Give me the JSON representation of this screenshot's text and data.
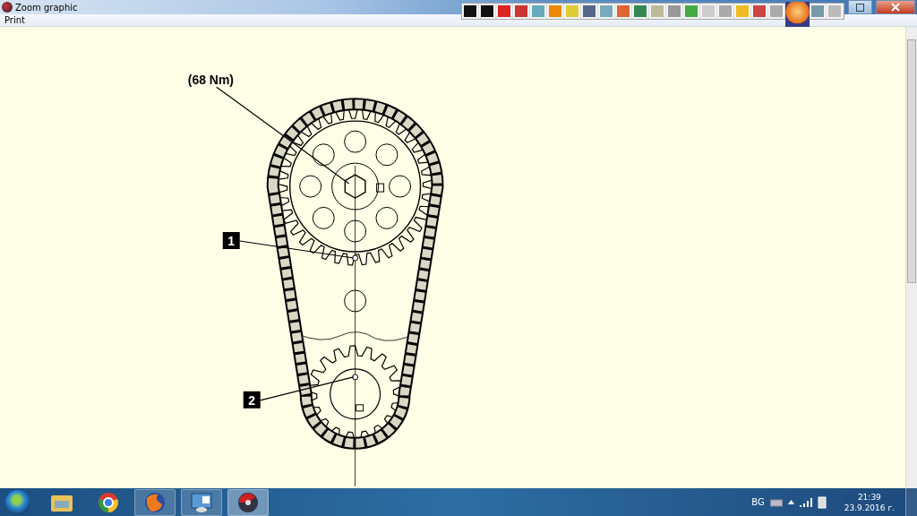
{
  "window": {
    "title": "Zoom graphic"
  },
  "menu": [
    {
      "label": "Print"
    }
  ],
  "diagram": {
    "torque_label": "(68 Nm)",
    "callouts": [
      {
        "number": "1"
      },
      {
        "number": "2"
      }
    ]
  },
  "tray": {
    "language": "BG",
    "time": "21:39",
    "date": "23.9.2016 г."
  }
}
